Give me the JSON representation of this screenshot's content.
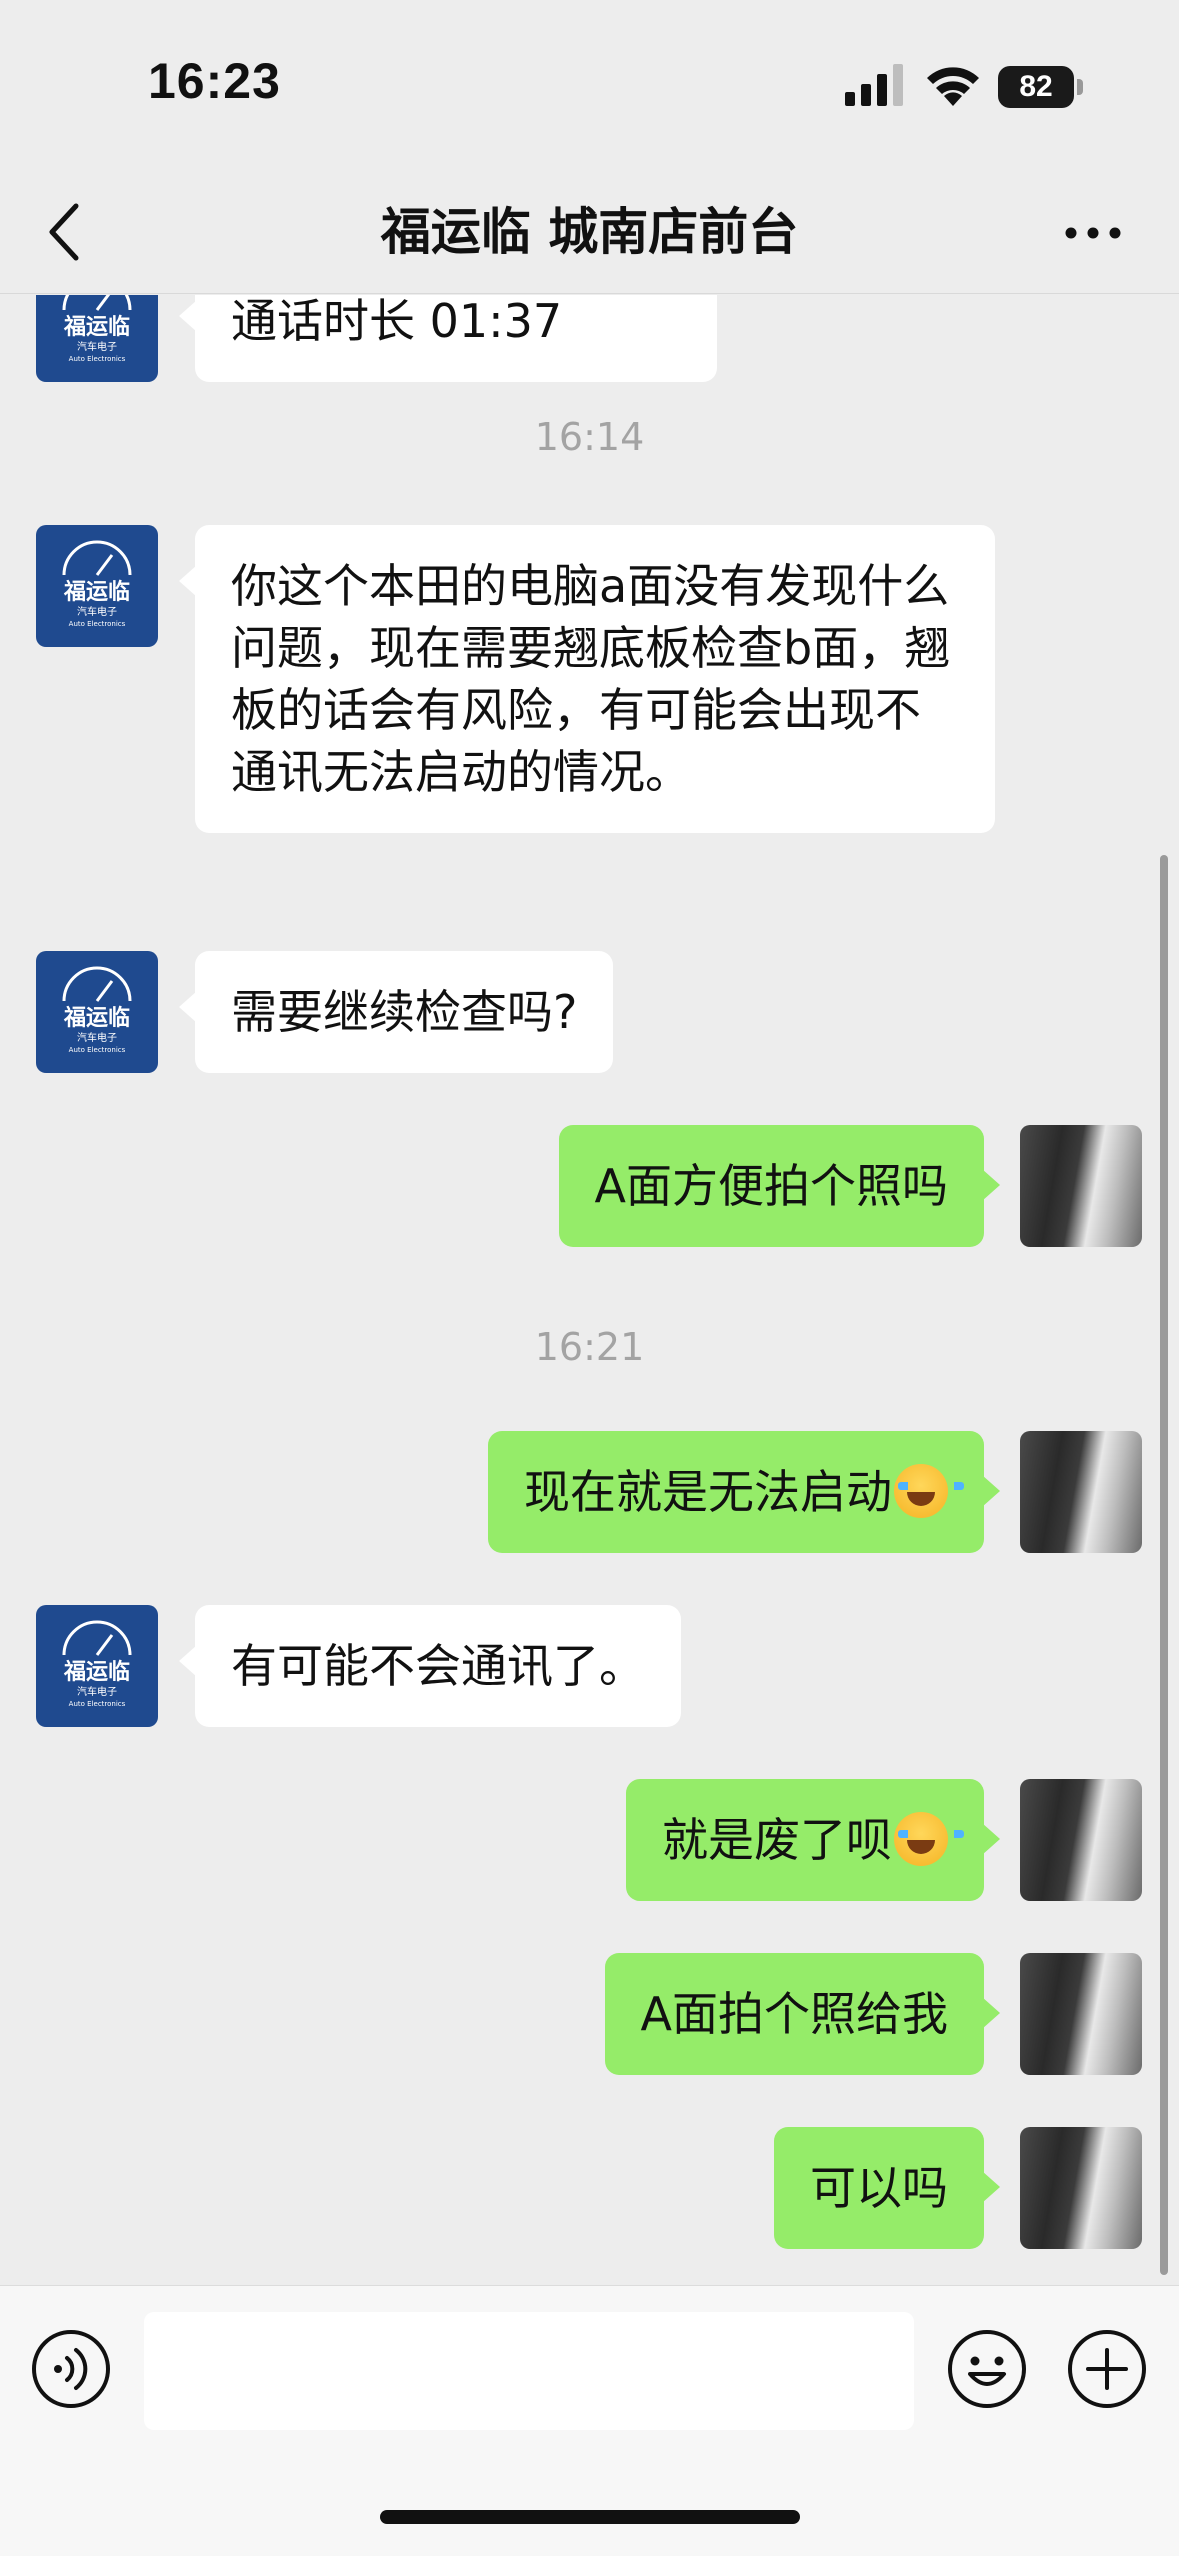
{
  "status_bar": {
    "time": "16:23",
    "battery": "82"
  },
  "header": {
    "title": "福运临 城南店前台"
  },
  "brand_avatar": {
    "name": "福运临",
    "sub": "汽车电子",
    "en": "Auto Electronics"
  },
  "messages": [
    {
      "side": "in",
      "text": "通话时长 01:37"
    },
    {
      "type": "time",
      "text": "16:14"
    },
    {
      "side": "in",
      "text": "你这个本田的电脑a面没有发现什么问题，现在需要翘底板检查b面，翘板的话会有风险，有可能会出现不通讯无法启动的情况。"
    },
    {
      "side": "in",
      "text": "需要继续检查吗?"
    },
    {
      "side": "out",
      "text": "A面方便拍个照吗"
    },
    {
      "type": "time",
      "text": "16:21"
    },
    {
      "side": "out",
      "text": "现在就是无法启动",
      "emoji": "cry-laugh"
    },
    {
      "side": "in",
      "text": "有可能不会通讯了。"
    },
    {
      "side": "out",
      "text": "就是废了呗",
      "emoji": "cry-laugh"
    },
    {
      "side": "out",
      "text": "A面拍个照给我"
    },
    {
      "side": "out",
      "text": "可以吗"
    }
  ],
  "input": {
    "placeholder": ""
  },
  "icons": {
    "back": "chevron-left-icon",
    "more": "more-dots-icon",
    "voice": "voice-icon",
    "emoji": "smiley-icon",
    "plus": "plus-icon"
  },
  "colors": {
    "outgoing_bubble": "#95ec69",
    "incoming_bubble": "#ffffff",
    "background": "#ededed",
    "brand": "#1f4a8f"
  }
}
